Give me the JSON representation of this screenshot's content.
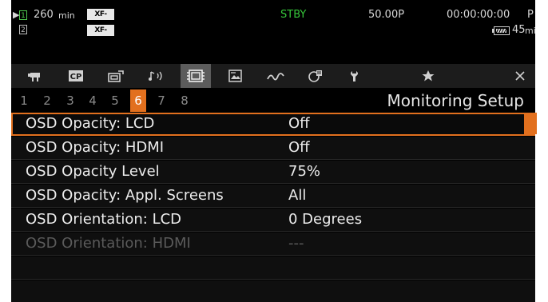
{
  "status": {
    "play_glyph": "▶",
    "slot1_label": "1",
    "slot2_label": "2",
    "remaining_time": "260",
    "remaining_unit": "min",
    "codec_primary": "XF-AVC",
    "codec_secondary": "XF-AVC",
    "mode": "STBY",
    "frame_rate": "50.00P",
    "timecode": "00:00:00:00",
    "timecode_suffix": "P",
    "battery_time": "45",
    "battery_unit": "min",
    "colors": {
      "mode": "#37c73a",
      "slot_active": "#4fc74f"
    }
  },
  "tabs": [
    {
      "icon": "movie-camera-icon"
    },
    {
      "icon": "custom-picture-icon",
      "text": "CP"
    },
    {
      "icon": "camera-setup-icon"
    },
    {
      "icon": "audio-icon"
    },
    {
      "icon": "monitoring-icon",
      "selected": true
    },
    {
      "icon": "recording-media-icon"
    },
    {
      "icon": "waveform-icon"
    },
    {
      "icon": "assign-button-icon"
    },
    {
      "icon": "system-wrench-icon"
    },
    {
      "icon": "my-menu-star-icon"
    },
    {
      "icon": "close-icon"
    }
  ],
  "pages": {
    "numbers": [
      "1",
      "2",
      "3",
      "4",
      "5",
      "6",
      "7",
      "8"
    ],
    "current": "6"
  },
  "section_title": "Monitoring Setup",
  "settings": [
    {
      "label": "OSD Opacity: LCD",
      "value": "Off",
      "selected": true
    },
    {
      "label": "OSD Opacity: HDMI",
      "value": "Off"
    },
    {
      "label": "OSD Opacity Level",
      "value": "75%"
    },
    {
      "label": "OSD Opacity: Appl. Screens",
      "value": "All"
    },
    {
      "label": "OSD Orientation: LCD",
      "value": "0 Degrees"
    },
    {
      "label": "OSD Orientation: HDMI",
      "value": "---",
      "disabled": true
    },
    {
      "label": "",
      "value": ""
    },
    {
      "label": "",
      "value": ""
    }
  ],
  "accent_color": "#e2701e"
}
